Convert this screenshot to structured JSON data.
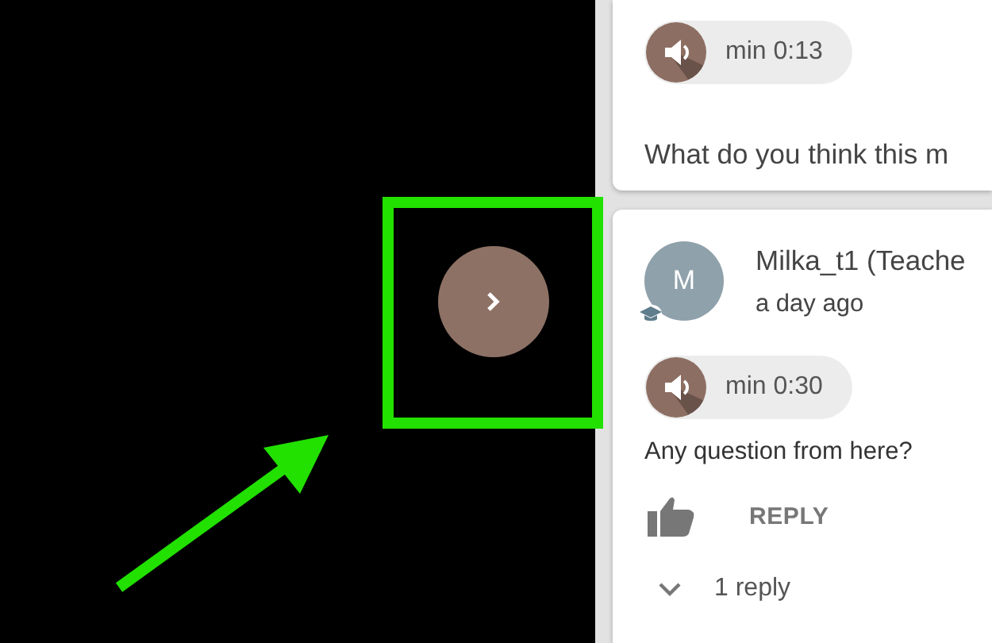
{
  "comments": [
    {
      "kind": "partial",
      "audio_time": "min 0:13",
      "text": "What do you think this m"
    },
    {
      "kind": "full",
      "author": "Milka_t1 (Teache",
      "avatar_initial": "M",
      "is_teacher": true,
      "time": "a day ago",
      "audio_time": "min 0:30",
      "text": "Any question from here?",
      "reply_button": "REPLY",
      "replies": "1 reply",
      "replies_expanded": false
    }
  ],
  "annotation": {
    "highlight": true,
    "arrow": true
  }
}
